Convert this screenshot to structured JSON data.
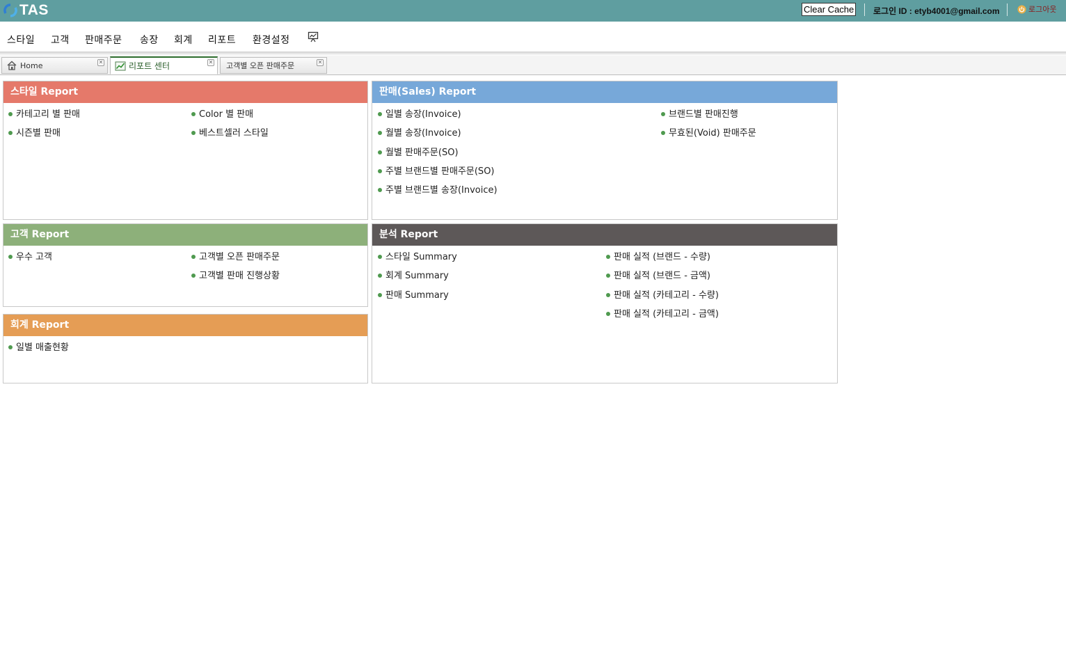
{
  "app": {
    "logo_text": "TAS",
    "clear_cache_label": "Clear Cache",
    "login_id_text": "로그인 ID : etyb4001@gmail.com",
    "logout_label": "로그아웃"
  },
  "menu": {
    "items": [
      "스타일",
      "고객",
      "판매주문",
      "송장",
      "회계",
      "리포트",
      "환경설정"
    ],
    "extra_icon": "monitor-chart-icon"
  },
  "tabs": [
    {
      "label": "Home",
      "icon": "home-icon",
      "active": false
    },
    {
      "label": "리포트 센터",
      "icon": "chart-icon",
      "active": true
    },
    {
      "label": "고객별 오픈 판매주문",
      "icon": "",
      "active": false
    }
  ],
  "colors": {
    "topbar": "#5f9ea0",
    "style_header": "#e5796a",
    "sales_header": "#77a8d9",
    "customer_header": "#8db07a",
    "analysis_header": "#5d5858",
    "accounting_header": "#e59d55",
    "bullet": "#4f9a4f"
  },
  "panels": {
    "style": {
      "title": "스타일 Report",
      "links": [
        "카테고리 별 판매",
        "Color 별 판매",
        "시즌별 판매",
        "베스트셀러 스타일"
      ]
    },
    "sales": {
      "title": "판매(Sales) Report",
      "links": [
        "일별 송장(Invoice)",
        "브랜드별 판매진행",
        "월별 송장(Invoice)",
        "무효된(Void) 판매주문",
        "월별 판매주문(SO)",
        "주별 브랜드별 판매주문(SO)",
        "주별 브랜드별 송장(Invoice)"
      ]
    },
    "customer": {
      "title": "고객 Report",
      "links": [
        "우수 고객",
        "고객별 오픈 판매주문",
        "고객별 판매 진행상황"
      ]
    },
    "analysis": {
      "title": "분석 Report",
      "links": [
        "스타일 Summary",
        "판매 실적 (브랜드 - 수량)",
        "회계 Summary",
        "판매 실적 (브랜드 - 금액)",
        "판매 Summary",
        "판매 실적 (카테고리 - 수량)",
        "판매 실적 (카테고리 - 금액)"
      ]
    },
    "accounting": {
      "title": "회계 Report",
      "links": [
        "일별 매출현황"
      ]
    }
  }
}
